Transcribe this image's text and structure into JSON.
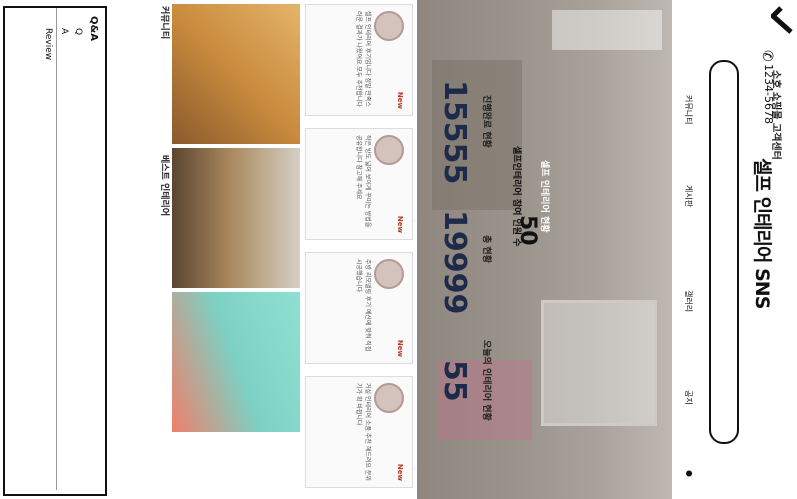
{
  "header": {
    "brand": "소호 쇼핑몰 고객센터",
    "title": "셀프 인테리어 SNS",
    "phone": "1234-5678",
    "nav": [
      "공지",
      "갤러리",
      "게시판",
      "커뮤니티"
    ]
  },
  "hero": {
    "caption": "셀프 인테리어 현황",
    "total_label": "셀프인테리어 참여 인원 수",
    "total_value": "50",
    "stats": [
      {
        "label": "진행완료 현황",
        "value": "15555"
      },
      {
        "label": "총 현황",
        "value": "19999"
      },
      {
        "label": "오늘의 인테리어 현황",
        "value": "55"
      }
    ]
  },
  "reviews": [
    {
      "badge": "New",
      "text": "셀프 인테리어 후기입니다 정말 만족스러운 결과가 나왔어요 모두 추천합니다"
    },
    {
      "badge": "New",
      "text": "작은 방도 넓어 보이게 꾸미는 방법을 공유합니다 참고해 주세요"
    },
    {
      "badge": "New",
      "text": "주방 리모델링 후기 예산에 맞춰 직접 시공했습니다"
    },
    {
      "badge": "New",
      "text": "거실 인테리어 소품 추천 해드려요 분위기가 확 바뀝니다"
    }
  ],
  "gallery": {
    "captions": [
      "커뮤니티",
      "베스트 인테리어"
    ]
  },
  "qna": {
    "title": "Q&A",
    "q": "Q",
    "a": "A",
    "review": "Review"
  }
}
